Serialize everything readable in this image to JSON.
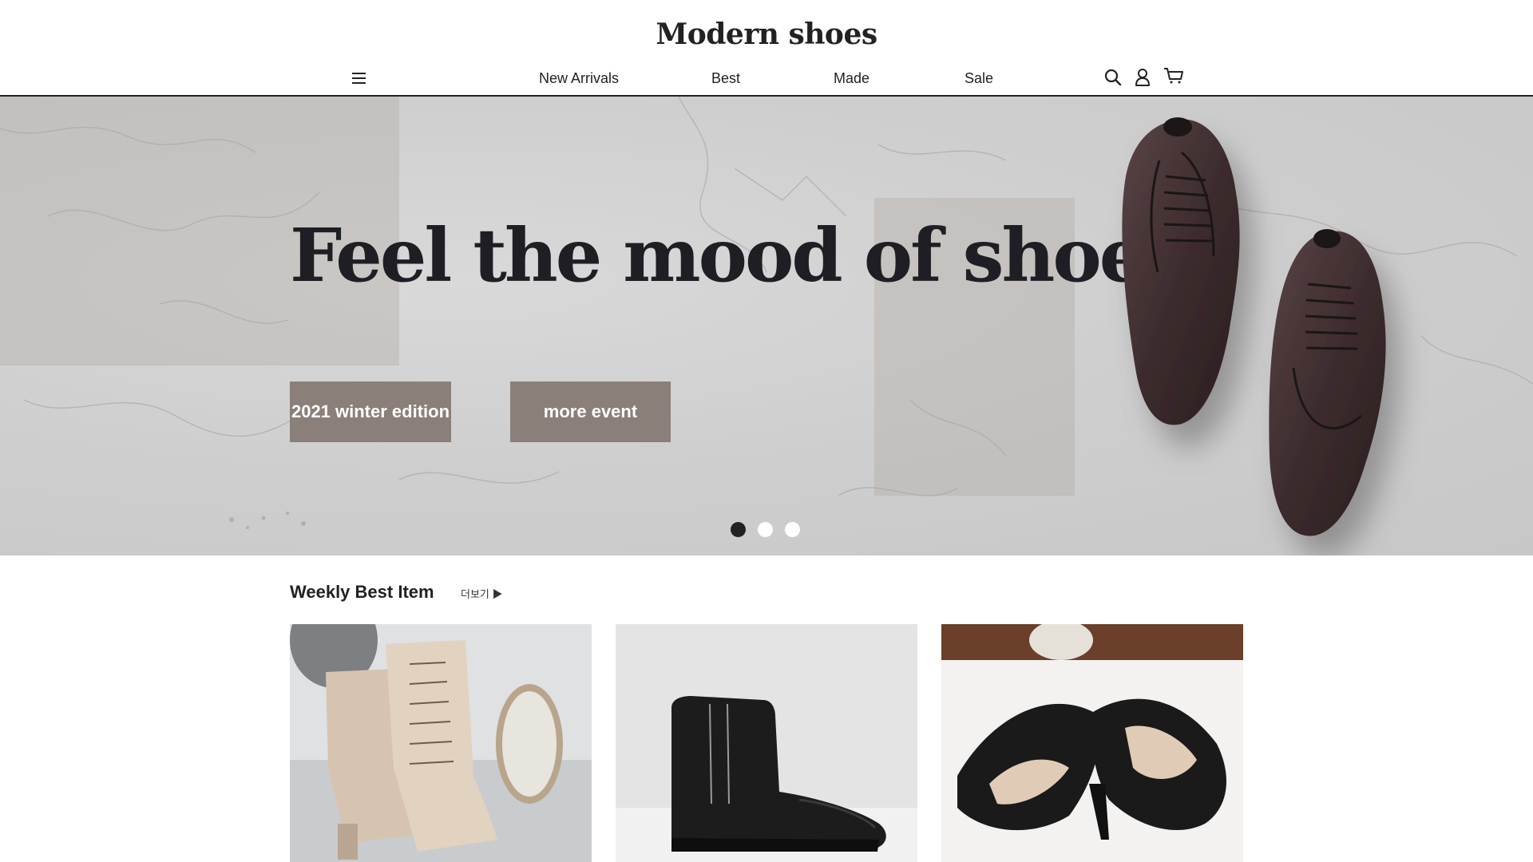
{
  "header": {
    "logo": "Modern shoes",
    "nav": [
      "New Arrivals",
      "Best",
      "Made",
      "Sale"
    ]
  },
  "hero": {
    "title": "Feel the mood of shoes",
    "buttons": [
      "2021 winter edition",
      "more event"
    ],
    "slides_total": 3,
    "active_slide": 1
  },
  "weekly": {
    "title": "Weekly Best Item",
    "more_label": "더보기 ▶"
  },
  "colors": {
    "accent_button": "#8a7f79",
    "text_dark": "#222222",
    "hero_bg": "#cfcfcf"
  },
  "icons": [
    "menu-icon",
    "search-icon",
    "user-icon",
    "cart-icon"
  ]
}
